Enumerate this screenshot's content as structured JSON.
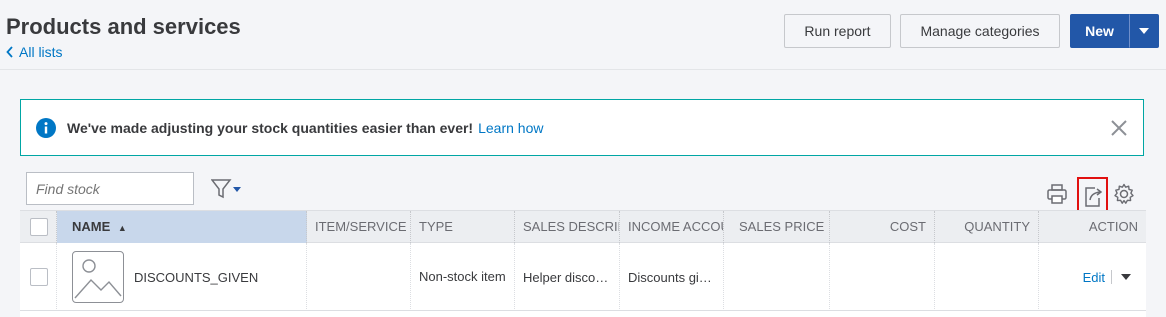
{
  "header": {
    "title": "Products and services",
    "back_link": "All lists",
    "run_report_label": "Run report",
    "manage_categories_label": "Manage categories",
    "new_label": "New"
  },
  "banner": {
    "message": "We've made adjusting your stock quantities easier than ever!",
    "link": "Learn how"
  },
  "toolbar": {
    "search_placeholder": "Find stock"
  },
  "table": {
    "columns": [
      "NAME",
      "ITEM/SERVICE C",
      "TYPE",
      "SALES DESCRIP",
      "INCOME ACCOU",
      "SALES PRICE",
      "COST",
      "QUANTITY",
      "ACTION"
    ],
    "sort_indicator": "▲",
    "rows": [
      {
        "name": "DISCOUNTS_GIVEN",
        "item_service_code": "",
        "type": "Non-stock item",
        "sales_description": "Helper disco…",
        "income_account": "Discounts gi…",
        "sales_price": "",
        "cost": "",
        "quantity": "",
        "action": "Edit"
      }
    ]
  },
  "colors": {
    "primary": "#2257a8",
    "link": "#0077c5",
    "banner_border": "#00a6a4",
    "highlight": "#e11010",
    "sorted_header": "#c8d7eb"
  },
  "icons": [
    "chevron-left-icon",
    "info-icon",
    "close-icon",
    "filter-icon",
    "print-icon",
    "export-icon",
    "gear-icon",
    "image-placeholder-icon",
    "caret-down-icon"
  ]
}
